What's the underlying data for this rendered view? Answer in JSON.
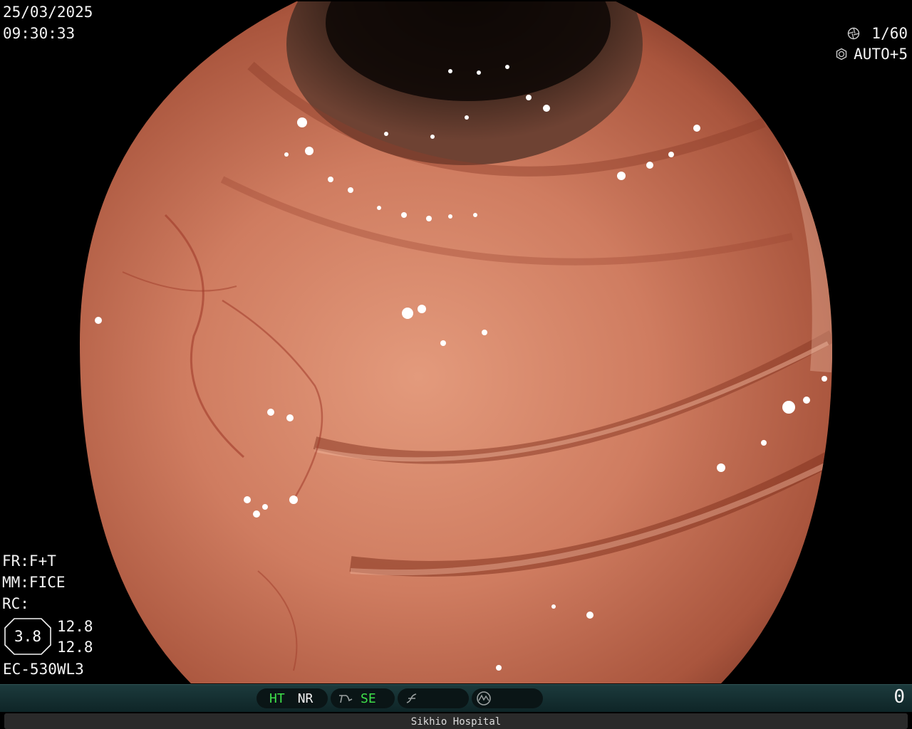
{
  "datetime": {
    "date": "25/03/2025",
    "time": "09:30:33"
  },
  "camera": {
    "shutter_icon": "shutter-icon",
    "shutter": "1/60",
    "iris_icon": "iris-icon",
    "iris_mode": "AUTO+5"
  },
  "settings": {
    "fr": "FR:F+T",
    "mm": "MM:FICE",
    "rc": "RC:",
    "zoom": "3.8",
    "value1": "12.8",
    "value2": "12.8",
    "scope_model": "EC-530WL3"
  },
  "status_bar": {
    "ht": "HT",
    "nr": "NR",
    "se_icon": "structure-enhancement-icon",
    "se": "SE",
    "color_icon": "color-enhancement-icon",
    "mode_icon": "mode-icon",
    "counter": "0"
  },
  "footer": {
    "hospital": "Sikhio Hospital"
  },
  "colors": {
    "mucosa": "#c8725a",
    "lumen": "#2a1a14",
    "status_green": "#3fe04a",
    "status_bar": "#163032"
  }
}
